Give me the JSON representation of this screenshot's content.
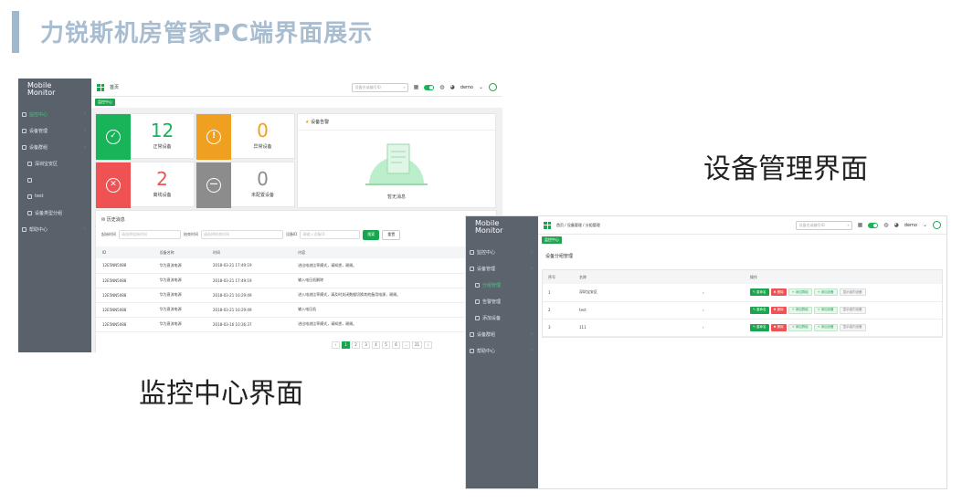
{
  "slide": {
    "title": "力锐斯机房管家PC端界面展示",
    "caption_monitor": "监控中心界面",
    "caption_device": "设备管理界面"
  },
  "brand": {
    "line1": "Mobile",
    "line2": "Monitor"
  },
  "shot1": {
    "nav": [
      {
        "label": "监控中心",
        "active": true
      },
      {
        "label": "设备管理"
      },
      {
        "label": "设备群组"
      },
      {
        "label": "深圳宝安区",
        "sub": true
      },
      {
        "label": "",
        "sub": true
      },
      {
        "label": "test",
        "sub": true
      },
      {
        "label": "设备类型分组",
        "sub": true
      },
      {
        "label": "帮助中心"
      }
    ],
    "breadcrumb": "首页",
    "search_placeholder": "设备名或编号ID",
    "user": "demo",
    "tab": "监控中心",
    "cards": [
      {
        "value": "12",
        "label": "正常设备",
        "color": "#19b35a",
        "icon": "check-icon",
        "glyph": "✓"
      },
      {
        "value": "0",
        "label": "异常设备",
        "color": "#f0a020",
        "icon": "exclamation-icon",
        "glyph": "!"
      },
      {
        "value": "2",
        "label": "离线设备",
        "color": "#ef5252",
        "icon": "close-icon",
        "glyph": "✕"
      },
      {
        "value": "0",
        "label": "未配置设备",
        "color": "#8c8c8c",
        "icon": "minus-icon",
        "glyph": "—"
      }
    ],
    "alarm_title": "设备告警",
    "alarm_empty": "暂无消息",
    "history_title": "历史消息",
    "filters": {
      "start_label": "起始时间",
      "start_placeholder": "请选择起始时间",
      "end_label": "结束时间",
      "end_placeholder": "请选择结束时间",
      "device_label": "设备ID",
      "device_placeholder": "请输入设备ID",
      "query": "搜索",
      "reset": "重置"
    },
    "columns": [
      "ID",
      "设备名称",
      "时间",
      "内容"
    ],
    "rows": [
      [
        "12E5NN5088",
        "华为直流电源",
        "2018-03-21 17:49:19",
        "进出电流比率模式，请知悉，谢谢。"
      ],
      [
        "12E5NN5088",
        "华为直流电源",
        "2018-03-21 17:49:19",
        "输入电压低解除"
      ],
      [
        "12E5NN5088",
        "华为直流电源",
        "2018-03-21 16:29:49",
        "进入电流比率模式，请及时关闭数据切换其他备用电源，谢谢。"
      ],
      [
        "12E5NN5088",
        "华为直流电源",
        "2018-03-21 16:29:49",
        "输入电压低"
      ],
      [
        "12E5NN5088",
        "华为直流电源",
        "2018-03-16 10:36:37",
        "进出电流比率模式，请知悉，谢谢。"
      ]
    ],
    "pager": [
      "‹",
      "1",
      "2",
      "3",
      "4",
      "5",
      "6",
      "…",
      "21",
      "›"
    ]
  },
  "shot2": {
    "nav": [
      {
        "label": "监控中心"
      },
      {
        "label": "设备管理"
      },
      {
        "label": "分组管理",
        "active": true,
        "sub": true
      },
      {
        "label": "告警管理",
        "sub": true
      },
      {
        "label": "添加设备",
        "sub": true
      },
      {
        "label": "设备群组"
      },
      {
        "label": "帮助中心"
      }
    ],
    "breadcrumb": "首页 / 设备管理 / 分组管理",
    "search_placeholder": "设备名或编号ID",
    "user": "demo",
    "tab": "监控中心",
    "page_title": "设备分组管理",
    "columns": [
      "序号",
      "名称",
      "",
      "操作"
    ],
    "rows": [
      [
        "1",
        "深圳宝安区",
        "›"
      ],
      [
        "2",
        "test",
        "›"
      ],
      [
        "3",
        "111",
        "›"
      ]
    ],
    "ops": [
      "✎ 重命名",
      "✖ 删除",
      "+ 添加群组",
      "+ 添加设备",
      "显示组内设备"
    ]
  }
}
